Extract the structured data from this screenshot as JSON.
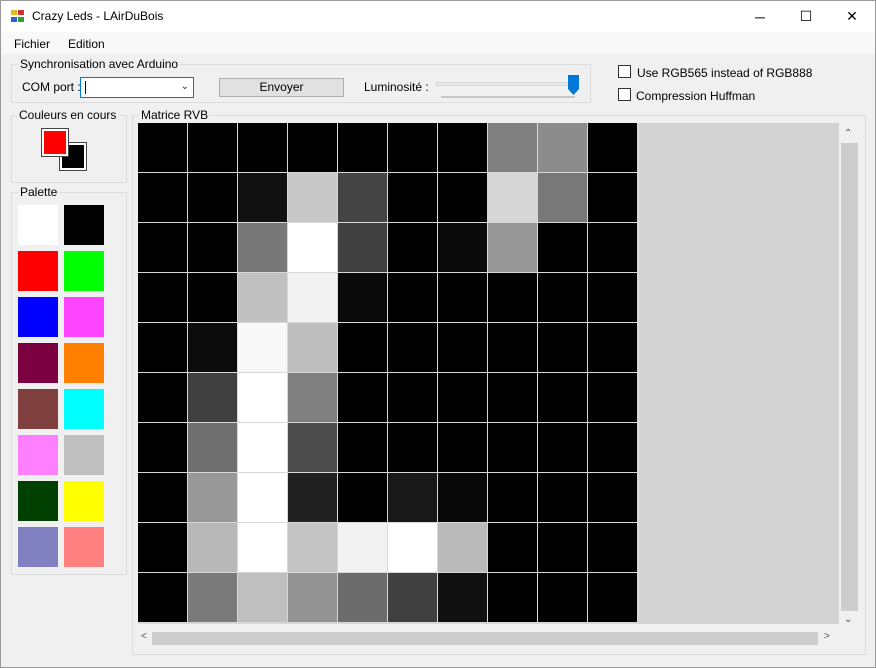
{
  "window": {
    "title": "Crazy Leds - LAirDuBois",
    "icon": "app-leds-icon",
    "controls": {
      "minimize": "─",
      "maximize": "☐",
      "close": "✕"
    }
  },
  "menu": [
    {
      "label": "Fichier"
    },
    {
      "label": "Edition"
    }
  ],
  "sync": {
    "group_title": "Synchronisation avec Arduino",
    "com_label": "COM port :",
    "com_value": "",
    "send_button": "Envoyer",
    "brightness_label": "Luminosité :",
    "brightness_level": 1.0
  },
  "options": {
    "rgb565": {
      "label": "Use RGB565 instead of RGB888",
      "checked": false
    },
    "huffman": {
      "label": "Compression Huffman",
      "checked": false
    }
  },
  "current_colors": {
    "title": "Couleurs en cours",
    "foreground": "#ff0000",
    "background": "#000000"
  },
  "palette": {
    "title": "Palette",
    "colors": [
      "#ffffff",
      "#000000",
      "#ff0000",
      "#00ff00",
      "#0000ff",
      "#ff44ff",
      "#7a0040",
      "#ff8000",
      "#804040",
      "#00ffff",
      "#ff80ff",
      "#c0c0c0",
      "#004000",
      "#ffff00",
      "#8080c0",
      "#ff8080"
    ]
  },
  "matrix": {
    "title": "Matrice RVB",
    "rows": 10,
    "cols": 10,
    "cells": [
      [
        "#000000",
        "#000000",
        "#000000",
        "#000000",
        "#000000",
        "#000000",
        "#000000",
        "#808080",
        "#8c8c8c",
        "#000000"
      ],
      [
        "#000000",
        "#000000",
        "#111111",
        "#c8c8c8",
        "#444444",
        "#000000",
        "#000000",
        "#d7d7d7",
        "#787878",
        "#000000"
      ],
      [
        "#000000",
        "#000000",
        "#777777",
        "#ffffff",
        "#404040",
        "#000000",
        "#0a0a0a",
        "#979797",
        "#000000",
        "#000000"
      ],
      [
        "#000000",
        "#000000",
        "#c0c0c0",
        "#f2f2f2",
        "#0a0a0a",
        "#000000",
        "#000000",
        "#000000",
        "#000000",
        "#000000"
      ],
      [
        "#000000",
        "#0c0c0c",
        "#f8f8f8",
        "#bebebe",
        "#000000",
        "#000000",
        "#000000",
        "#000000",
        "#000000",
        "#000000"
      ],
      [
        "#000000",
        "#404040",
        "#ffffff",
        "#808080",
        "#000000",
        "#000000",
        "#000000",
        "#000000",
        "#000000",
        "#000000"
      ],
      [
        "#000000",
        "#707070",
        "#ffffff",
        "#4c4c4c",
        "#000000",
        "#000000",
        "#000000",
        "#000000",
        "#000000",
        "#000000"
      ],
      [
        "#000000",
        "#989898",
        "#ffffff",
        "#202020",
        "#000000",
        "#181818",
        "#080808",
        "#000000",
        "#000000",
        "#000000"
      ],
      [
        "#000000",
        "#b8b8b8",
        "#ffffff",
        "#c4c4c4",
        "#f2f2f2",
        "#ffffff",
        "#bababa",
        "#000000",
        "#000000",
        "#000000"
      ],
      [
        "#000000",
        "#7a7a7a",
        "#bfbfbf",
        "#939393",
        "#6c6c6c",
        "#404040",
        "#101010",
        "#000000",
        "#000000",
        "#000000"
      ]
    ]
  }
}
